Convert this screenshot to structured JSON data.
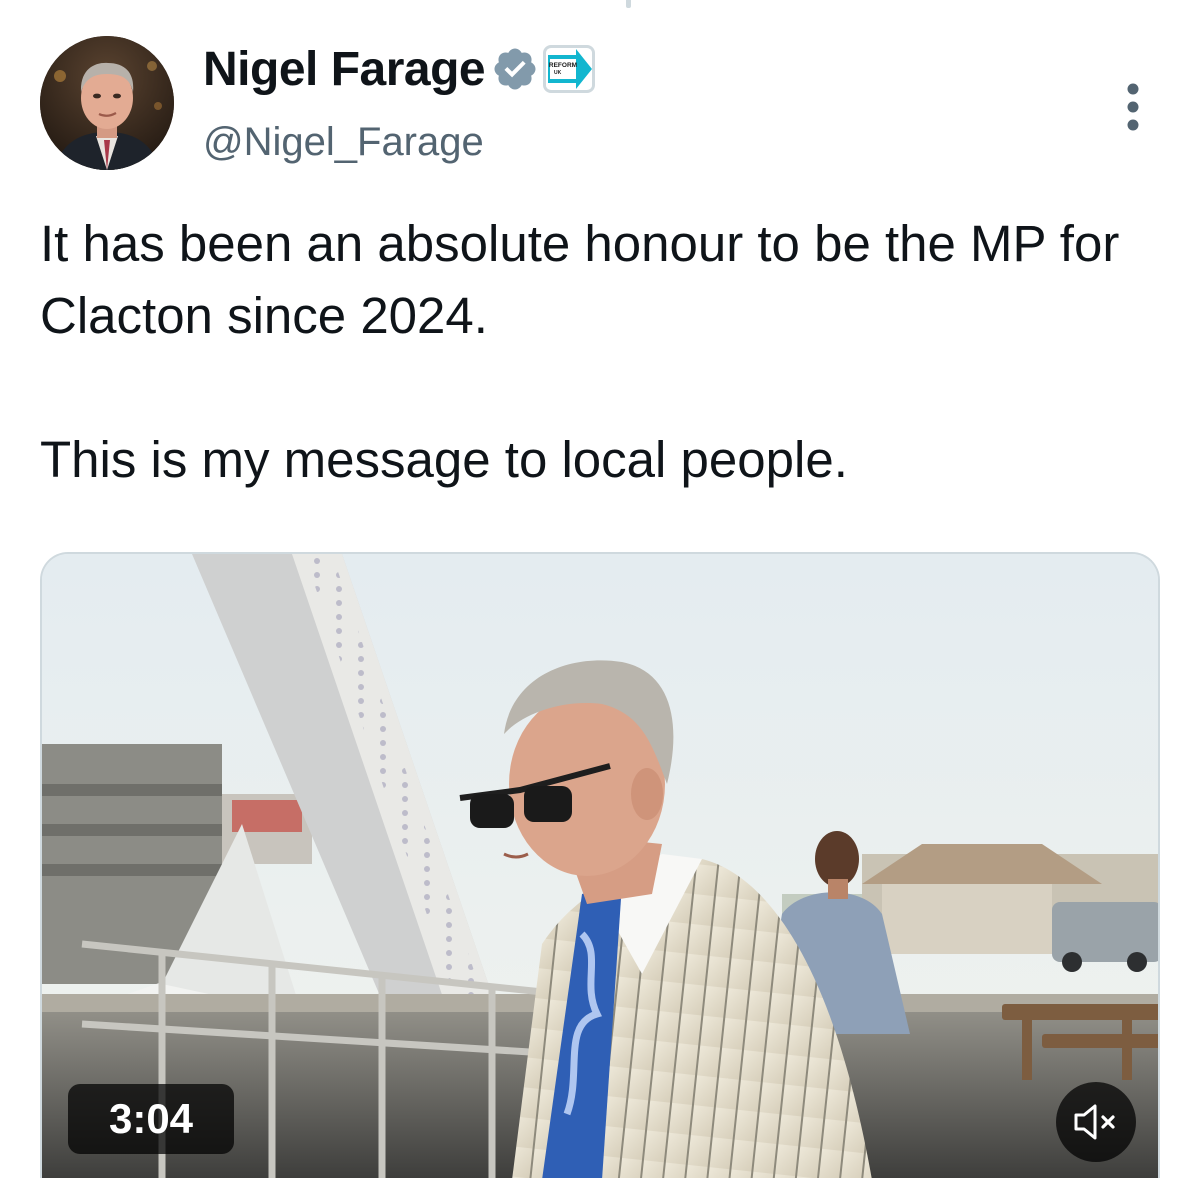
{
  "author": {
    "display_name": "Nigel Farage",
    "handle": "@Nigel_Farage",
    "verified_icon": "verified-badge-icon",
    "affiliate_badge_text": "REFORM UK",
    "avatar_icon": "profile-photo"
  },
  "tweet": {
    "paragraphs": [
      "It has been an absolute honour to be the MP for Clacton since 2024.",
      "This is my message to local people."
    ]
  },
  "media": {
    "type": "video",
    "duration": "3:04",
    "mute_icon": "speaker-muted-icon"
  },
  "colors": {
    "verified": "#829aab",
    "affiliate_accent": "#12b6cf",
    "secondary_text": "#536471",
    "border": "#cfd9de"
  }
}
